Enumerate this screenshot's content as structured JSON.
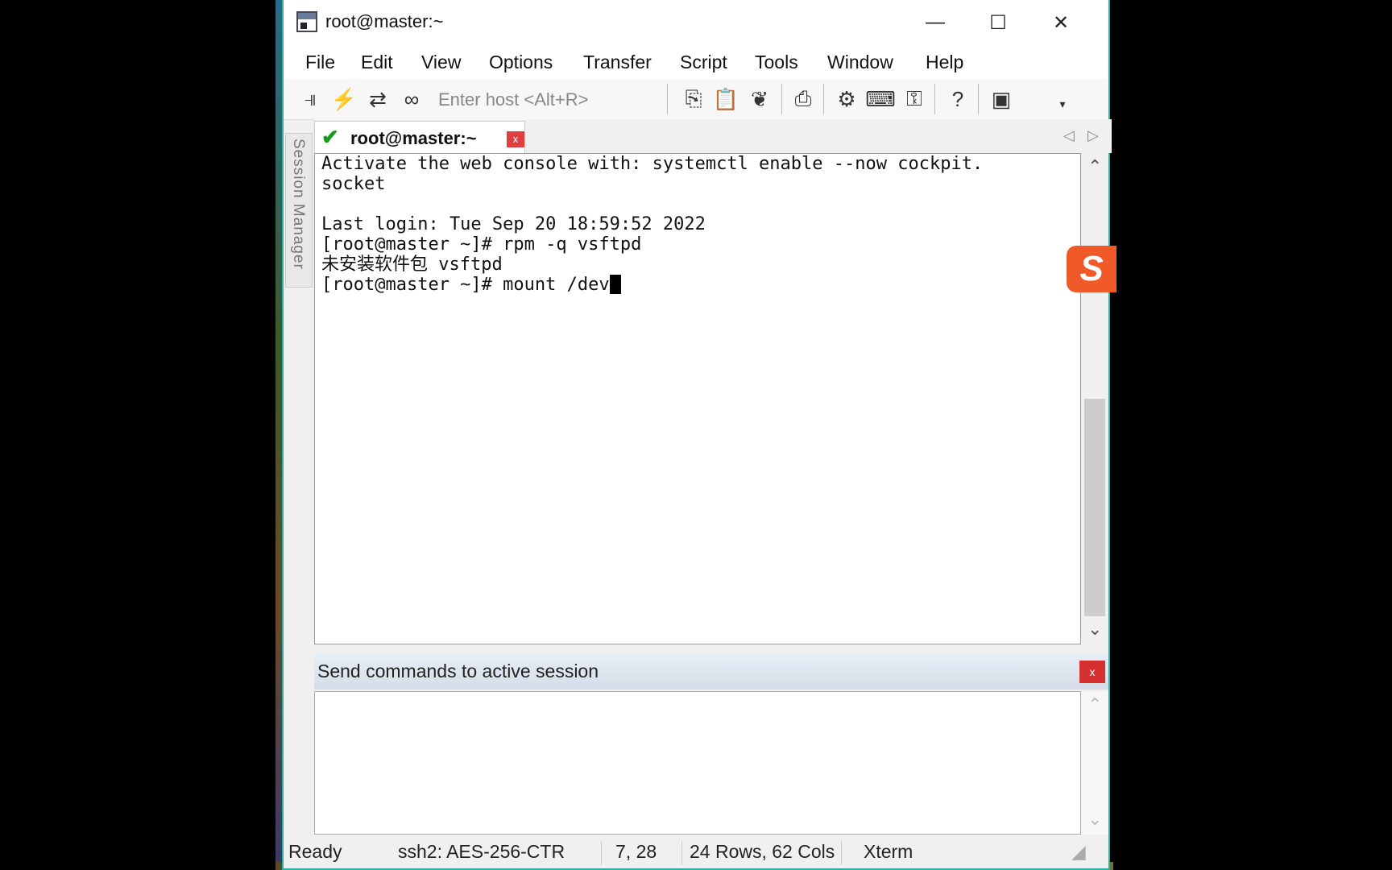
{
  "window": {
    "title": "root@master:~"
  },
  "menu": [
    "File",
    "Edit",
    "View",
    "Options",
    "Transfer",
    "Script",
    "Tools",
    "Window",
    "Help"
  ],
  "toolbar": {
    "host_placeholder": "Enter host <Alt+R>"
  },
  "sidebar": {
    "label": "Session Manager"
  },
  "tab": {
    "label": "root@master:~",
    "close": "x"
  },
  "terminal": {
    "lines": [
      "Activate the web console with: systemctl enable --now cockpit.",
      "socket",
      "",
      "Last login: Tue Sep 20 18:59:52 2022",
      "[root@master ~]# rpm -q vsftpd",
      "未安装软件包 vsftpd",
      "[root@master ~]# mount /dev"
    ]
  },
  "command_panel": {
    "title": "Send commands to active session",
    "close": "x"
  },
  "status": {
    "state": "Ready",
    "cipher": "ssh2: AES-256-CTR",
    "position": "7, 28",
    "size": "24 Rows, 62 Cols",
    "term": "Xterm"
  }
}
